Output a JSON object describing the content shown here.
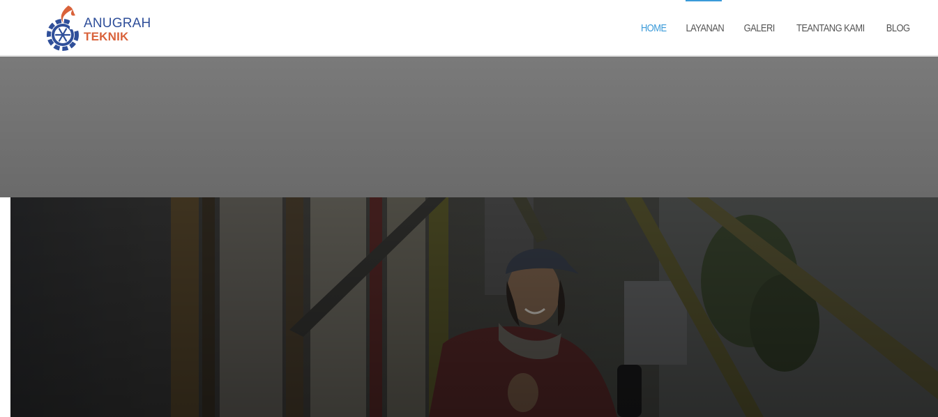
{
  "brand": {
    "line1": "ANUGRAH",
    "line2": "TEKNIK",
    "colors": {
      "blue": "#2f4f9a",
      "orange": "#d9623a"
    }
  },
  "nav": {
    "items": [
      {
        "label": "HOME",
        "active": true
      },
      {
        "label": "LAYANAN",
        "active": false
      },
      {
        "label": "GALERI",
        "active": false
      },
      {
        "label": "TEANTANG KAMI",
        "active": false
      },
      {
        "label": "BLOG",
        "active": false
      }
    ],
    "accent": "#3a9ad9"
  },
  "hero": {
    "overlay": "dark",
    "icon": "technician-photo"
  }
}
